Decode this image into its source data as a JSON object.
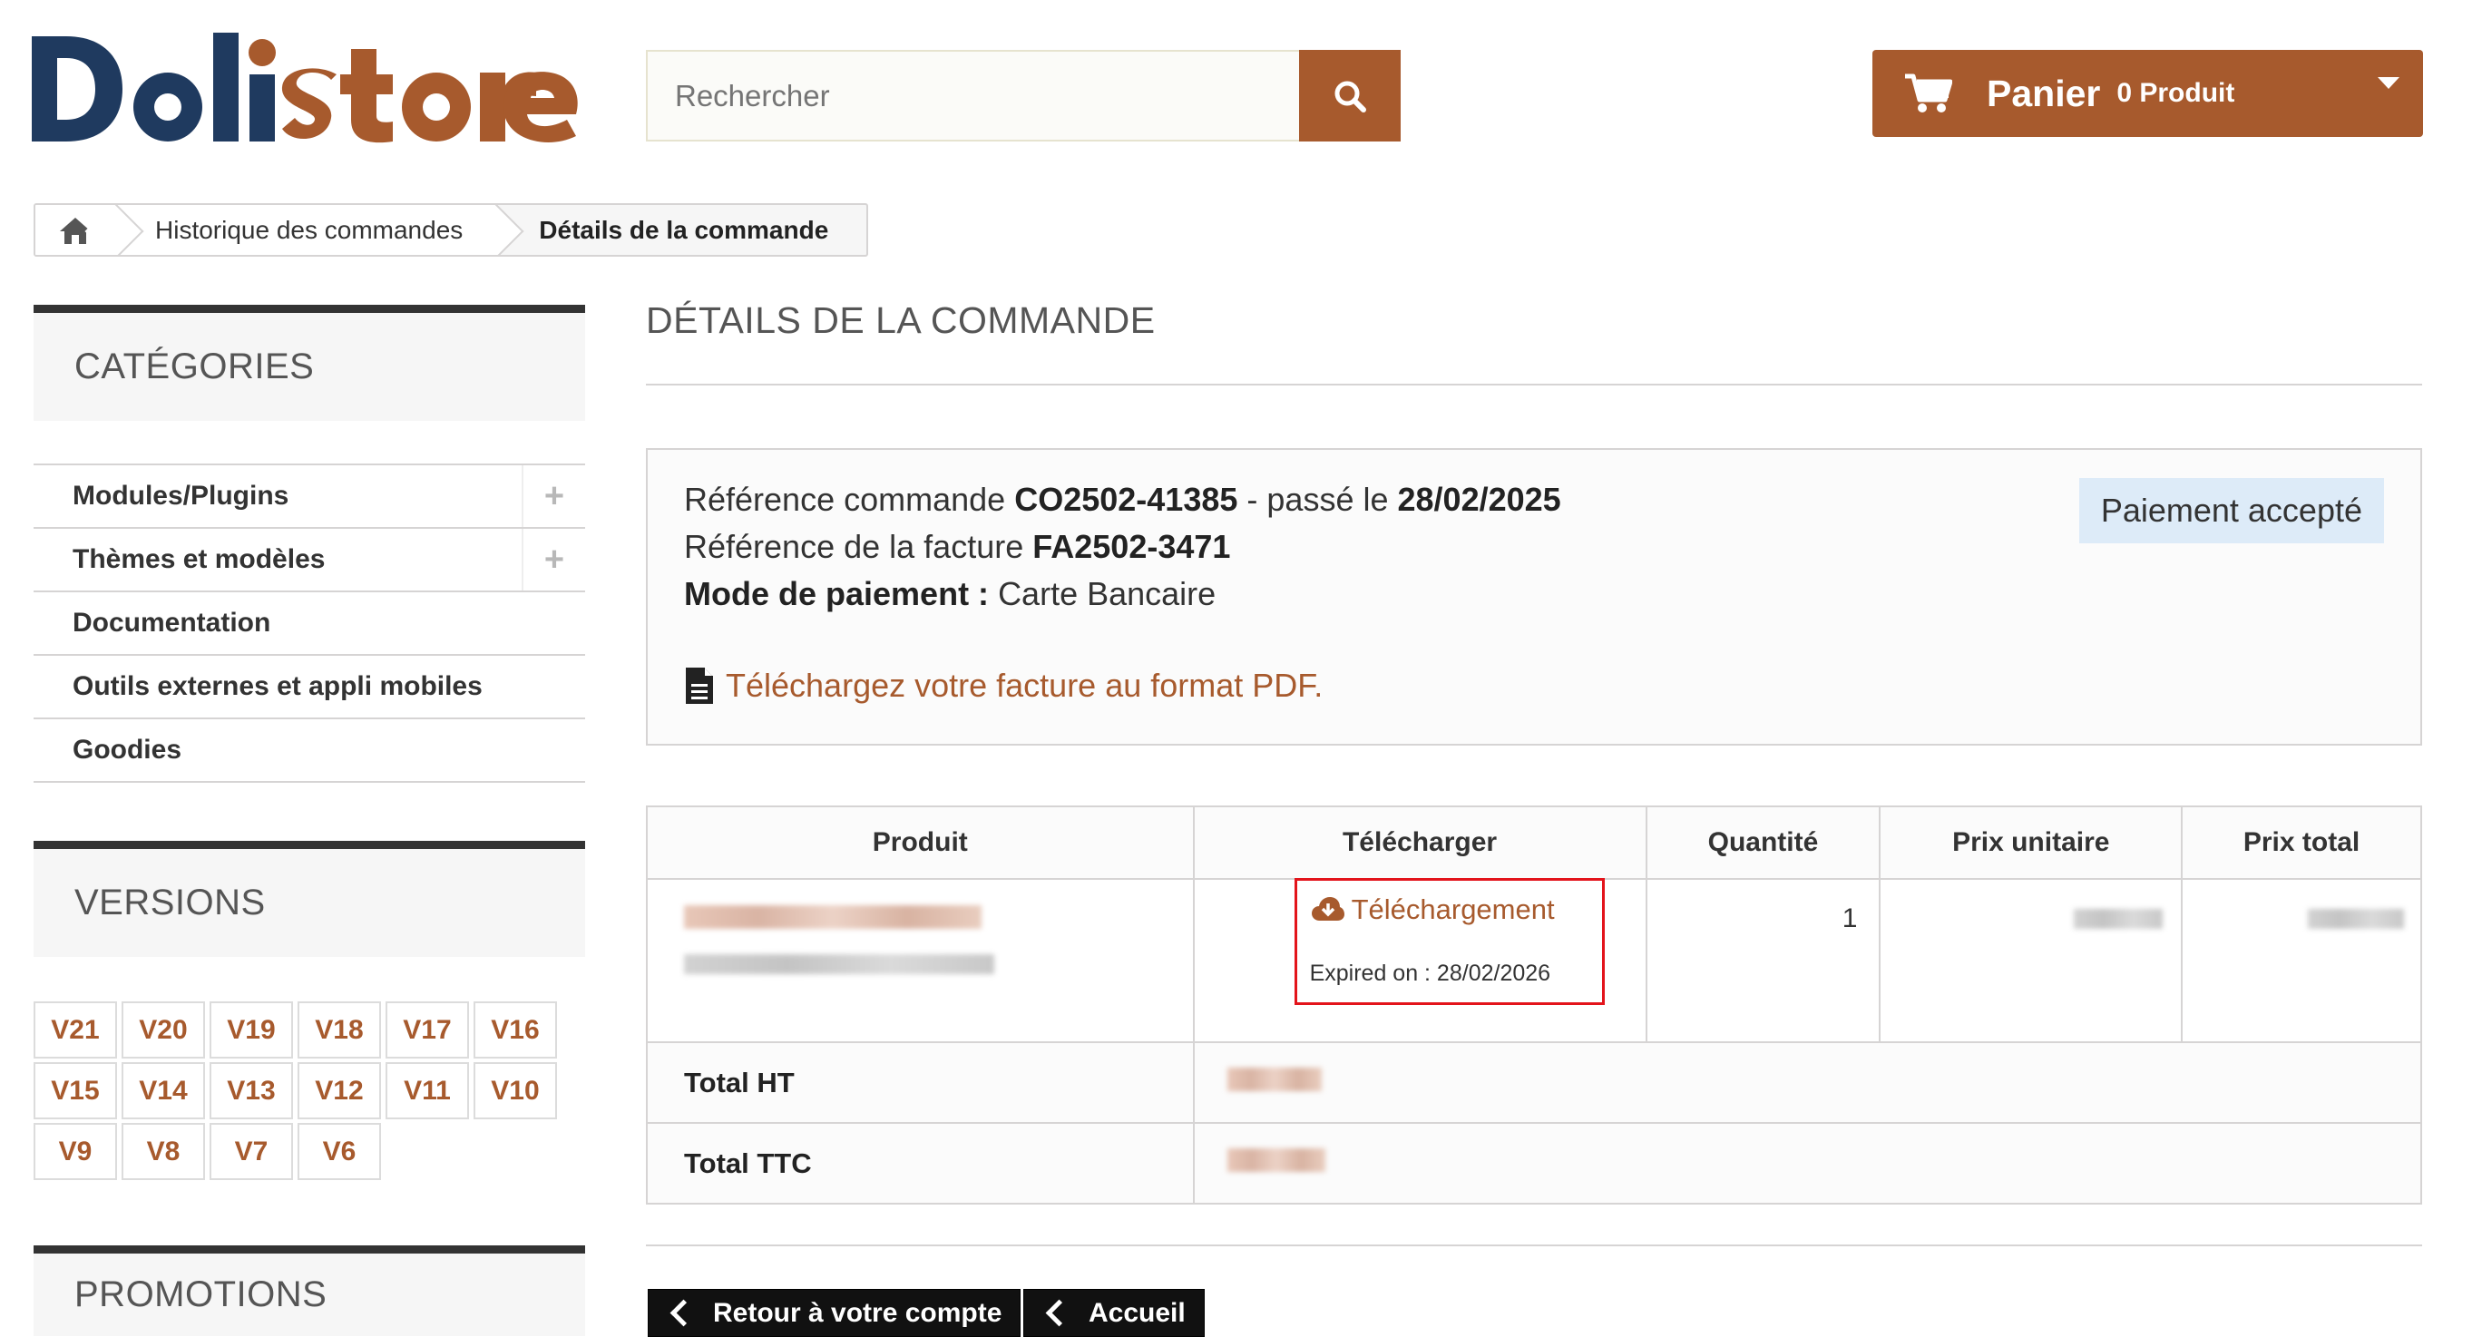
{
  "brand": {
    "logo_text": "Dolistore",
    "accent": "#a75a2d"
  },
  "search": {
    "placeholder": "Rechercher",
    "icon": "search-icon"
  },
  "cart": {
    "label": "Panier",
    "count_text": "0 Produit",
    "icon": "cart-icon"
  },
  "breadcrumb": {
    "home_icon": "home-icon",
    "items": [
      "Historique des commandes",
      "Détails de la commande"
    ]
  },
  "sidebar": {
    "categories_title": "CATÉGORIES",
    "categories": [
      {
        "label": "Modules/Plugins",
        "expandable": true
      },
      {
        "label": "Thèmes et modèles",
        "expandable": true
      },
      {
        "label": "Documentation",
        "expandable": false
      },
      {
        "label": "Outils externes et appli mobiles",
        "expandable": false
      },
      {
        "label": "Goodies",
        "expandable": false
      }
    ],
    "expand_symbol": "+",
    "versions_title": "VERSIONS",
    "versions": [
      "V21",
      "V20",
      "V19",
      "V18",
      "V17",
      "V16",
      "V15",
      "V14",
      "V13",
      "V12",
      "V11",
      "V10",
      "V9",
      "V8",
      "V7",
      "V6"
    ],
    "promotions_title": "PROMOTIONS"
  },
  "main": {
    "heading": "DÉTAILS DE LA COMMANDE",
    "order": {
      "ref_label": "Référence commande",
      "ref_value": "CO2502-41385",
      "placed_label": "- passé le",
      "placed_date": "28/02/2025",
      "invoice_label": "Référence de la facture",
      "invoice_value": "FA2502-3471",
      "payment_label": "Mode de paiement :",
      "payment_value": "Carte Bancaire",
      "status": "Paiement accepté",
      "status_color": "#ddebf8",
      "pdf_link": "Téléchargez votre facture au format PDF.",
      "pdf_icon": "file-text-icon"
    },
    "table": {
      "headers": [
        "Produit",
        "Télécharger",
        "Quantité",
        "Prix unitaire",
        "Prix total"
      ],
      "row": {
        "download_label": "Téléchargement",
        "download_icon": "cloud-download-icon",
        "expiry": "Expired on : 28/02/2026",
        "quantity": "1"
      },
      "total_ht_label": "Total HT",
      "total_ttc_label": "Total TTC"
    },
    "buttons": {
      "back": "Retour à votre compte",
      "home": "Accueil"
    }
  }
}
